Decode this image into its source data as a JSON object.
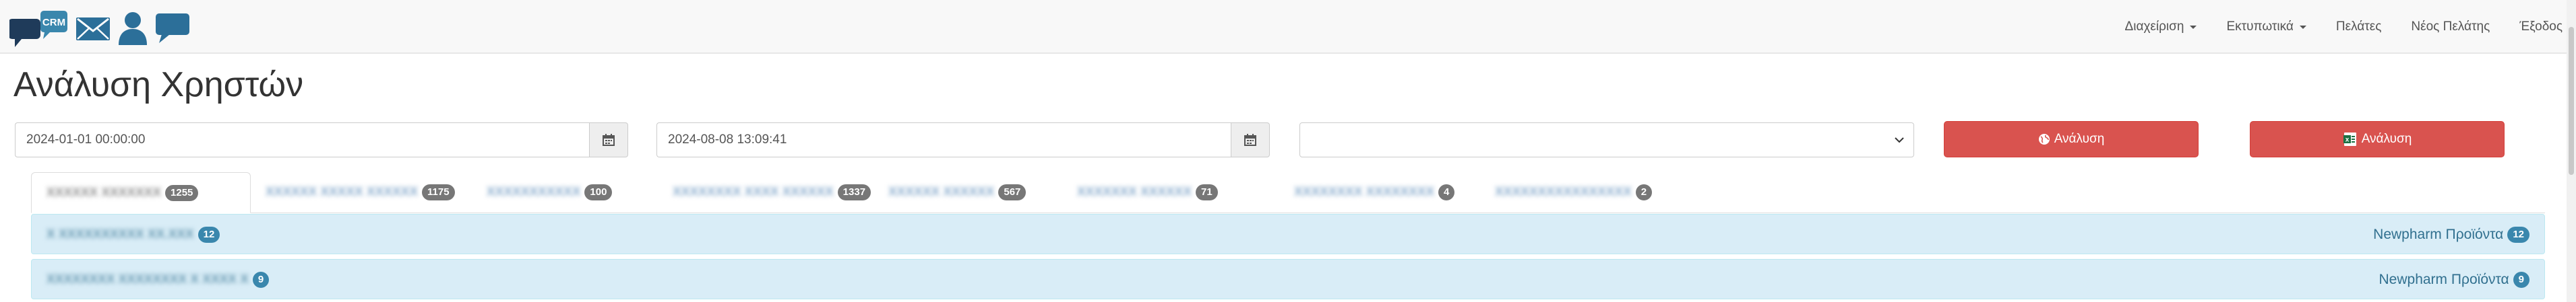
{
  "brand": {
    "crm_label": "CRM",
    "icons": [
      "chat-crm-icon",
      "mail-icon",
      "user-icon",
      "comment-icon"
    ]
  },
  "nav": [
    {
      "label": "Διαχείριση",
      "dropdown": true
    },
    {
      "label": "Εκτυπωτικά",
      "dropdown": true
    },
    {
      "label": "Πελάτες",
      "dropdown": false
    },
    {
      "label": "Νέος Πελάτης",
      "dropdown": false
    },
    {
      "label": "Έξοδος",
      "dropdown": false
    }
  ],
  "page_title": "Ανάλυση Χρηστών",
  "filters": {
    "date_from": "2024-01-01 00:00:00",
    "date_to": "2024-08-08 13:09:41",
    "select_value": ""
  },
  "buttons": {
    "analyze": "Ανάλυση",
    "analyze_excel": "Ανάλυση",
    "excel_icon_letter": "x"
  },
  "tabs": [
    {
      "label": "XXXXXX XXXXXXX",
      "count": "1255",
      "active": true
    },
    {
      "label": "XXXXXX XXXXX XXXXXX",
      "count": "1175"
    },
    {
      "label": "XXXXXXXXXXX",
      "count": "100"
    },
    {
      "label": "XXXXXXXX XXXX XXXXXX",
      "count": "1337"
    },
    {
      "label": "XXXXXX XXXXXX",
      "count": "567"
    },
    {
      "label": "XXXXXXX XXXXXX",
      "count": "71"
    },
    {
      "label": "XXXXXXXX XXXXXXXX",
      "count": "4"
    },
    {
      "label": "XXXXXXXXXXXXXXXX",
      "count": "2"
    }
  ],
  "rows": [
    {
      "left_label": "X XXXXXXXXXX XX.XXX",
      "left_count": "12",
      "right_label": "Newpharm Προϊόντα",
      "right_count": "12"
    },
    {
      "left_label": "XXXXXXXX XXXXXXXX X XXXX X",
      "left_count": "9",
      "right_label": "Newpharm Προϊόντα",
      "right_count": "9"
    }
  ]
}
